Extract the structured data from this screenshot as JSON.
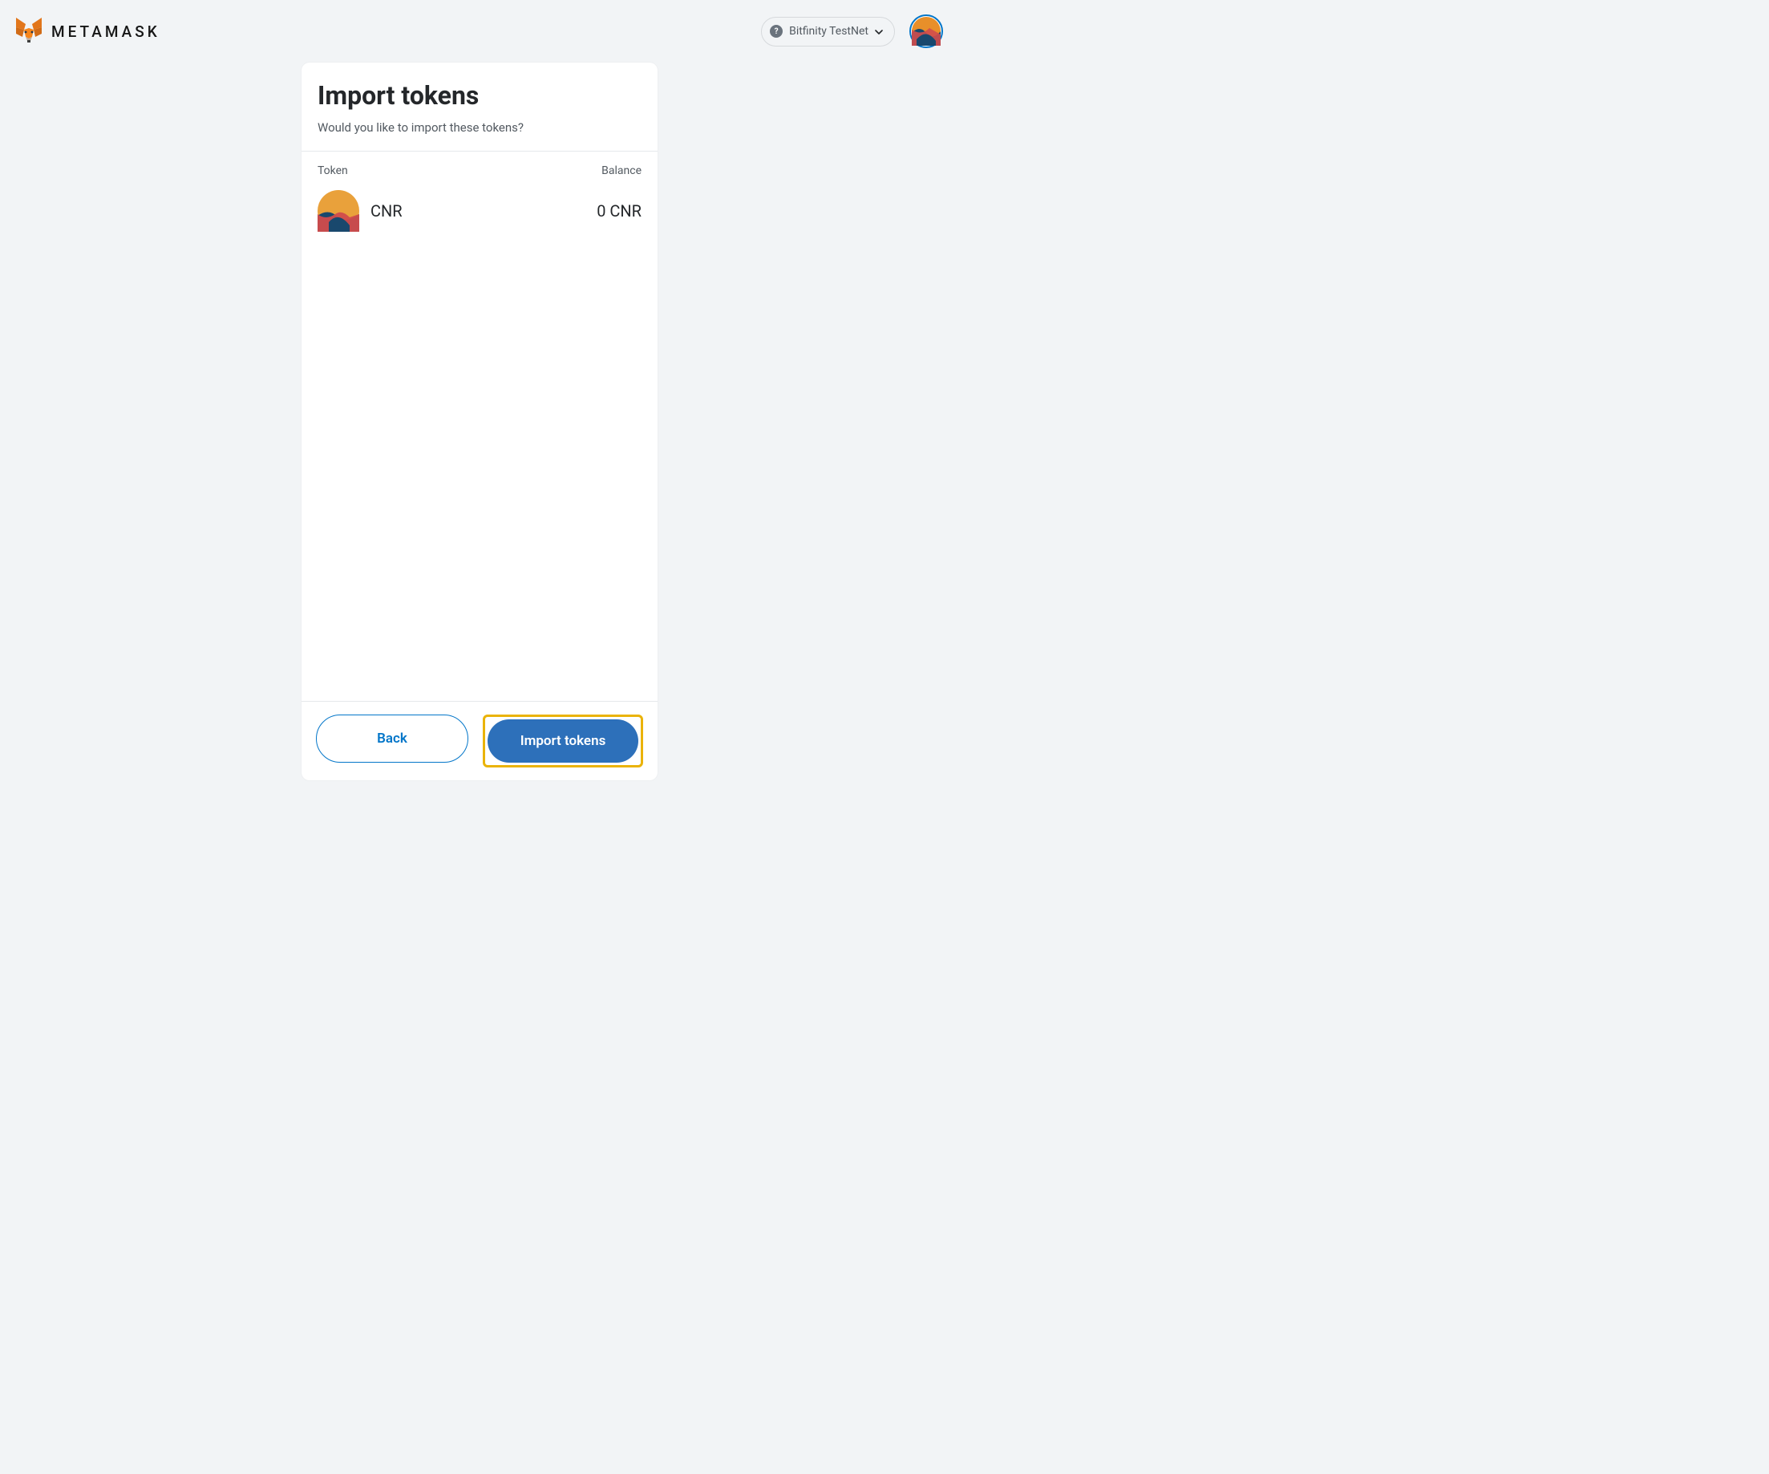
{
  "header": {
    "brand": "METAMASK",
    "network": "Bitfinity TestNet"
  },
  "card": {
    "title": "Import tokens",
    "subtitle": "Would you like to import these tokens?",
    "col_token": "Token",
    "col_balance": "Balance"
  },
  "tokens": [
    {
      "symbol": "CNR",
      "balance": "0 CNR"
    }
  ],
  "footer": {
    "back": "Back",
    "import": "Import tokens"
  }
}
